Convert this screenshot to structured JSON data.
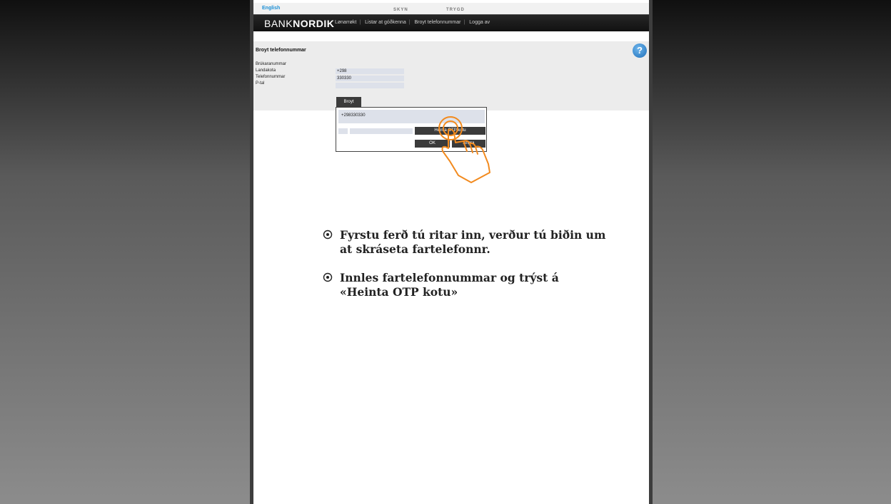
{
  "header": {
    "language_link": "English",
    "links": [
      "SKYN",
      "TRYGD"
    ]
  },
  "navbar": {
    "logo_part1": "BANK",
    "logo_part2": "NORDIK",
    "items": [
      "Lønarrøkt",
      "Listar at góðkenna",
      "Broyt telefonnummar",
      "Logga av"
    ]
  },
  "panel": {
    "title": "Broyt telefonnummar",
    "help_symbol": "?",
    "fields": [
      {
        "label": "Brúkaranummar",
        "value": ""
      },
      {
        "label": "Landakota",
        "value": "+298"
      },
      {
        "label": "Telefonnummar",
        "value": "330330"
      },
      {
        "label": "P-tal",
        "value": ""
      }
    ]
  },
  "dialog": {
    "tab_label": "Broyt",
    "phone_value": "+298330330",
    "otp_button": "Heinta OTP kotu",
    "ok_button": "OK",
    "cancel_button": "Angra"
  },
  "annotation": {
    "icon": "hand-pointer-icon",
    "accent_color": "#f28a1e"
  },
  "bullets": [
    "Fyrstu ferð tú ritar inn, verður tú biðin um at skráseta fartelefonnr.",
    "Innles fartelefonnummar og trýst á «Heinta OTP kotu»"
  ]
}
